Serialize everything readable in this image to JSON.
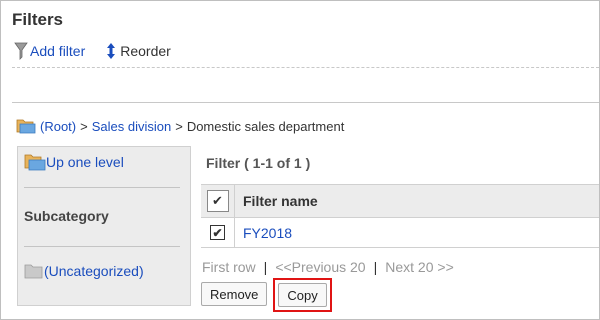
{
  "header": {
    "title": "Filters"
  },
  "toolbar": {
    "add_filter": "Add filter",
    "reorder": "Reorder"
  },
  "breadcrumb": {
    "root": "(Root)",
    "sep1": ">",
    "division": "Sales division",
    "sep2": ">",
    "current": "Domestic sales department"
  },
  "sidebar": {
    "up_one_level": "Up one level",
    "subcategory_heading": "Subcategory",
    "uncategorized": "(Uncategorized)"
  },
  "list": {
    "header": "Filter ( 1-1 of 1 )",
    "column_name": "Filter name",
    "rows": [
      {
        "name": "FY2018",
        "checked": true
      }
    ]
  },
  "pager": {
    "first": "First row",
    "separator": "|",
    "previous": "<<Previous 20",
    "next": "Next 20 >>"
  },
  "actions": {
    "remove": "Remove",
    "copy": "Copy"
  },
  "icons": {
    "add_filter": "funnel-icon",
    "reorder": "up-down-arrow-icon",
    "folder": "folder-icon",
    "checkmark": "✔"
  },
  "colors": {
    "link": "#1a4dbd",
    "highlight": "#e01414",
    "panel": "#ececec"
  }
}
